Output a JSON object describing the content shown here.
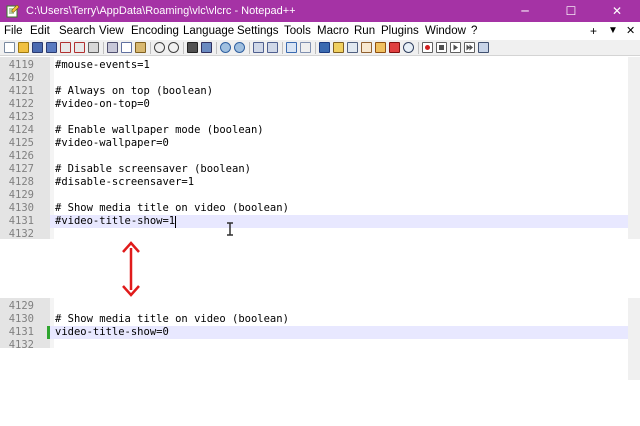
{
  "window": {
    "title": "C:\\Users\\Terry\\AppData\\Roaming\\vlc\\vlcrc - Notepad++",
    "minimize": "─",
    "maximize": "☐",
    "close": "✕"
  },
  "menu": {
    "items": [
      "File",
      "Edit",
      "Search",
      "View",
      "Encoding",
      "Language",
      "Settings",
      "Tools",
      "Macro",
      "Run",
      "Plugins",
      "Window",
      "?"
    ],
    "right": [
      "+",
      "▼",
      "✕"
    ]
  },
  "toolbar": {
    "icons": [
      "new-file-icon",
      "open-file-icon",
      "save-icon",
      "save-all-icon",
      "close-icon",
      "close-all-icon",
      "print-icon",
      "cut-icon",
      "copy-icon",
      "paste-icon",
      "undo-icon",
      "redo-icon",
      "find-icon",
      "replace-icon",
      "zoom-in-icon",
      "zoom-out-icon",
      "sync-vertical-icon",
      "sync-horizontal-icon",
      "word-wrap-icon",
      "show-all-chars-icon",
      "indent-guide-icon",
      "user-lang-icon",
      "doc-map-icon",
      "function-list-icon",
      "folder-workspace-icon",
      "monitor-icon",
      "record-macro-icon",
      "stop-record-icon",
      "play-macro-icon",
      "play-multiple-icon",
      "save-macro-icon"
    ]
  },
  "editor_top": {
    "lines": [
      {
        "num": "4119",
        "text": "#mouse-events=1"
      },
      {
        "num": "4120",
        "text": ""
      },
      {
        "num": "4121",
        "text": "# Always on top (boolean)"
      },
      {
        "num": "4122",
        "text": "#video-on-top=0"
      },
      {
        "num": "4123",
        "text": ""
      },
      {
        "num": "4124",
        "text": "# Enable wallpaper mode (boolean)"
      },
      {
        "num": "4125",
        "text": "#video-wallpaper=0"
      },
      {
        "num": "4126",
        "text": ""
      },
      {
        "num": "4127",
        "text": "# Disable screensaver (boolean)"
      },
      {
        "num": "4128",
        "text": "#disable-screensaver=1"
      },
      {
        "num": "4129",
        "text": ""
      },
      {
        "num": "4130",
        "text": "# Show media title on video (boolean)"
      },
      {
        "num": "4131",
        "text": "#video-title-show=1"
      },
      {
        "num": "4132",
        "text": ""
      }
    ],
    "current_line": "4131"
  },
  "editor_bottom": {
    "lines": [
      {
        "num": "4129",
        "text": ""
      },
      {
        "num": "4130",
        "text": "# Show media title on video (boolean)"
      },
      {
        "num": "4131",
        "text": "video-title-show=0"
      },
      {
        "num": "4132",
        "text": ""
      }
    ],
    "current_line": "4131"
  },
  "colors": {
    "title_bar": "#a533a5",
    "gutter": "#e4e4e4",
    "current_line": "#e8e8ff",
    "change_marker": "#2fa52f",
    "arrow": "#e01b1b"
  }
}
